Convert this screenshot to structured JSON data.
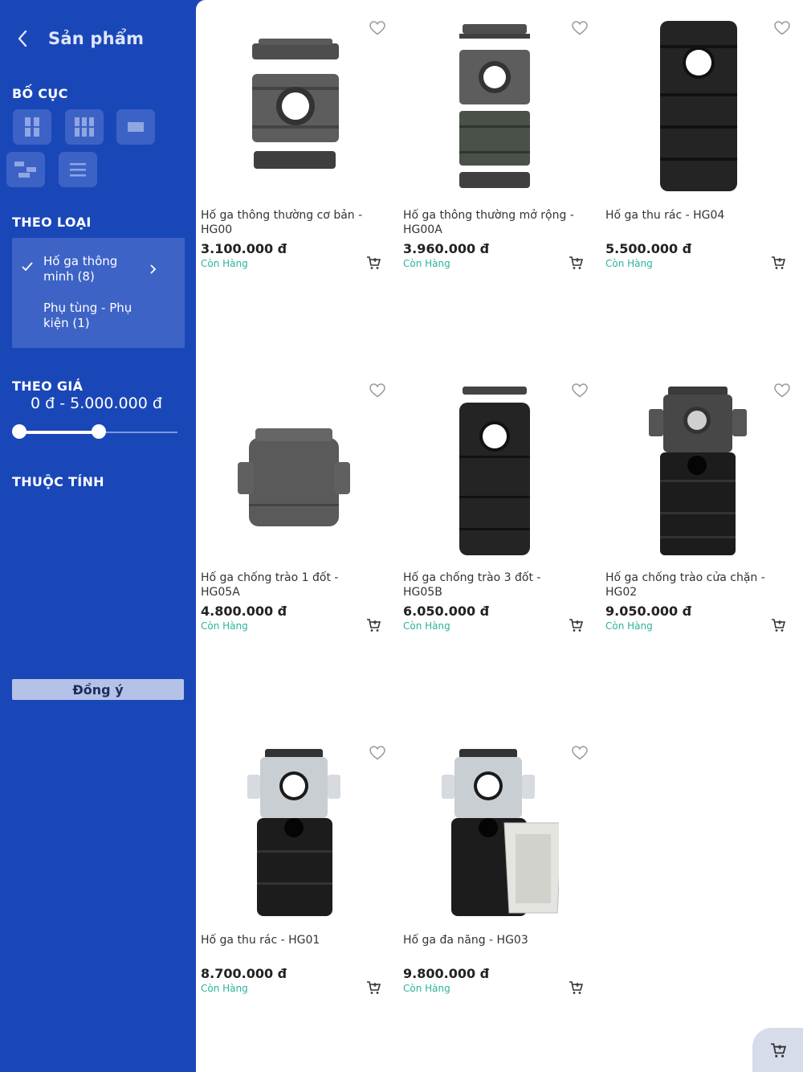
{
  "header": {
    "title": "Sản phẩm"
  },
  "sections": {
    "layout": "BỐ CỤC",
    "category": "THEO LOẠI",
    "price": "THEO GIÁ",
    "attribute": "THUỘC TÍNH"
  },
  "categories": [
    {
      "label": "Hố ga thông minh  (8)",
      "selected": true
    },
    {
      "label": "Phụ tùng - Phụ kiện  (1)",
      "selected": false
    }
  ],
  "price_filter": {
    "range_text": "0 đ - 5.000.000 đ",
    "min_fraction": 0.0,
    "max_fraction": 0.5
  },
  "agree_label": "Đồng ý",
  "products": [
    {
      "name": "Hố ga thông thường cơ bản - HG00",
      "price": "3.100.000 đ",
      "stock": "Còn Hàng"
    },
    {
      "name": "Hố ga thông thường mở rộng - HG00A",
      "price": "3.960.000 đ",
      "stock": "Còn Hàng"
    },
    {
      "name": "Hố ga thu rác - HG04",
      "price": "5.500.000 đ",
      "stock": "Còn Hàng"
    },
    {
      "name": "Hố ga chống trào 1 đốt - HG05A",
      "price": "4.800.000 đ",
      "stock": "Còn Hàng"
    },
    {
      "name": "Hố ga chống trào 3 đốt - HG05B",
      "price": "6.050.000 đ",
      "stock": "Còn Hàng"
    },
    {
      "name": "Hố ga chống trào cửa chặn - HG02",
      "price": "9.050.000 đ",
      "stock": "Còn Hàng"
    },
    {
      "name": "Hố ga thu rác - HG01",
      "price": "8.700.000 đ",
      "stock": "Còn Hàng"
    },
    {
      "name": "Hố ga đa năng - HG03",
      "price": "9.800.000 đ",
      "stock": "Còn Hàng"
    }
  ],
  "colors": {
    "sidebar": "#1a47b8",
    "accent_stock": "#2bb39a",
    "button": "#b4c2e7"
  }
}
